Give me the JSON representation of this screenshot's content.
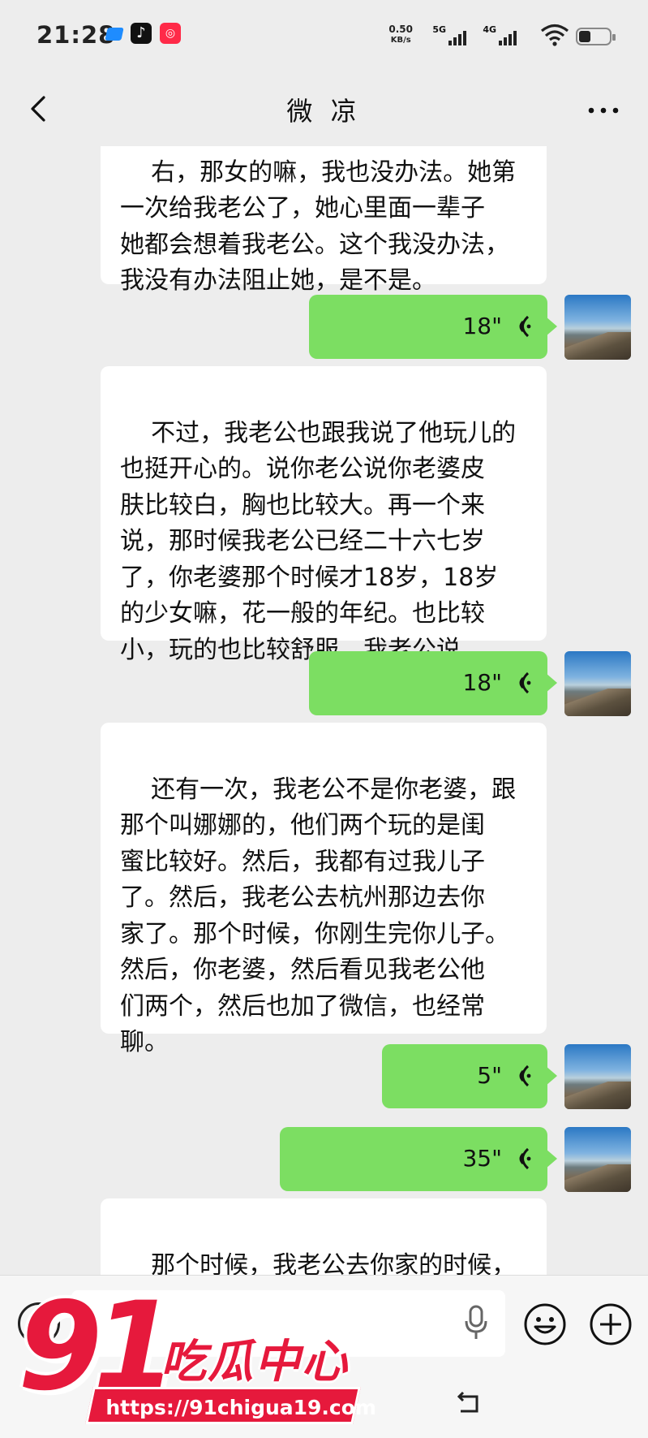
{
  "status_bar": {
    "time": "21:28",
    "net_speed_value": "0.50",
    "net_speed_unit": "KB/s",
    "signal1_label": "5G",
    "signal2_label": "4G",
    "battery_level": 0.3
  },
  "header": {
    "title": "微 凉",
    "back_icon": "chevron-left-icon",
    "more_icon": "more-dots-icon"
  },
  "messages": [
    {
      "direction": "in",
      "text": "右，那女的嘛，我也没办法。她第\n一次给我老公了，她心里面一辈子\n她都会想着我老公。这个我没办法，\n我没有办法阻止她，是不是。"
    },
    {
      "direction": "out",
      "type": "voice",
      "duration": "18\""
    },
    {
      "direction": "in",
      "text": "不过，我老公也跟我说了他玩儿的\n也挺开心的。说你老公说你老婆皮\n肤比较白，胸也比较大。再一个来\n说，那时候我老公已经二十六七岁\n了，你老婆那个时候才18岁，18岁\n的少女嘛，花一般的年纪。也比较\n小，玩的也比较舒服，我老公说。"
    },
    {
      "direction": "out",
      "type": "voice",
      "duration": "18\""
    },
    {
      "direction": "in",
      "text": "还有一次，我老公不是你老婆，跟\n那个叫娜娜的，他们两个玩的是闺\n蜜比较好。然后，我都有过我儿子\n了。然后，我老公去杭州那边去你\n家了。那个时候，你刚生完你儿子。\n然后，你老婆，然后看见我老公他\n们两个，然后也加了微信，也经常\n聊。"
    },
    {
      "direction": "out",
      "type": "voice",
      "duration": "5\""
    },
    {
      "direction": "out",
      "type": "voice",
      "duration": "35\""
    },
    {
      "direction": "in",
      "text": "那个时候，我老公去你家的时候，\n是那一个就是你老婆的闺蜜叫娜娜"
    }
  ],
  "input_bar": {
    "voice_toggle_icon": "voice-toggle-icon",
    "mic_icon": "mic-icon",
    "emoji_icon": "emoji-icon",
    "plus_icon": "plus-icon"
  },
  "watermark": {
    "number": "91",
    "name": "吃瓜中心",
    "url": "https://91chigua19.com"
  },
  "colors": {
    "background": "#ededed",
    "bubble_out": "#7cde62",
    "bubble_in": "#ffffff",
    "watermark_red": "#e6193c"
  }
}
